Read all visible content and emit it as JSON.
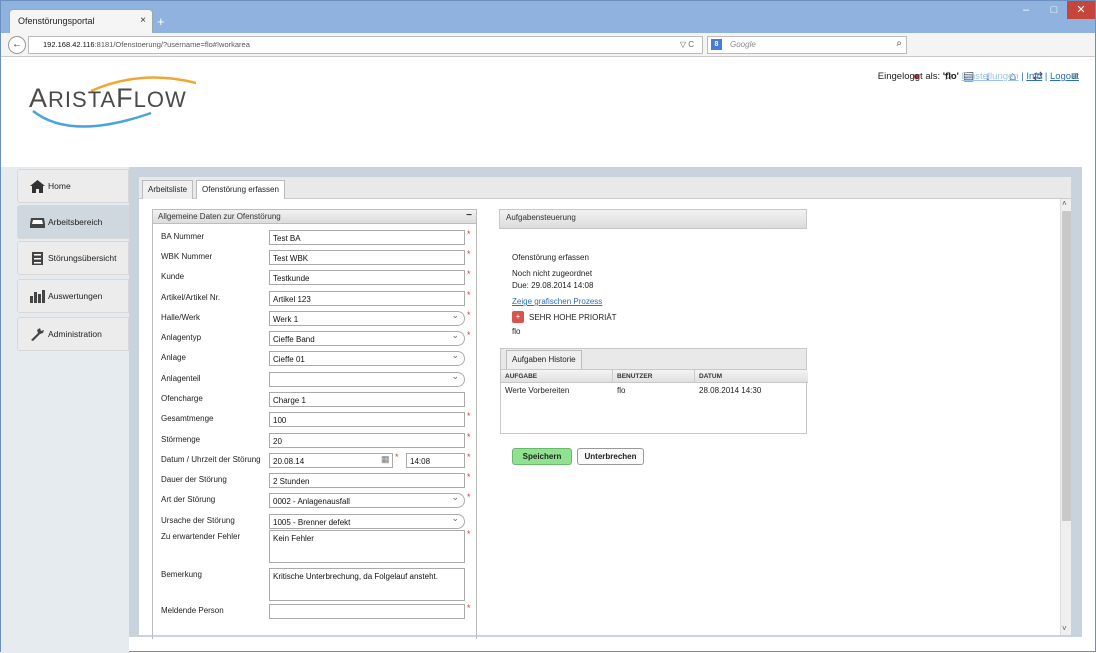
{
  "browser": {
    "tab_title": "Ofenstörungsportal",
    "tab_close": "×",
    "new_tab": "+",
    "url_host": "192.168.42.116",
    "url_rest": ":8181/Ofenstoerung/?username=flo#!workarea",
    "url_right": "▽ C",
    "search_engine_label": "8",
    "search_placeholder": "Google",
    "search_icon": "⌕",
    "toolbar_icons": [
      "abp-icon",
      "star-icon",
      "clipboard-icon",
      "download-icon",
      "home-icon",
      "extension-icon",
      "menu-icon"
    ],
    "window_buttons": [
      "–",
      "□",
      "✕"
    ]
  },
  "header": {
    "logo_text_big": "A",
    "logo_text_small": "RISTA",
    "logo_text_big2": "F",
    "logo_text_small2": "LOW",
    "logged_in_label": "Eingeloggt als:",
    "user": "'flo'",
    "settings_link": "Einstellungen",
    "sep": "|",
    "info_link": "Info",
    "logout_link": "Logout"
  },
  "sidebar": {
    "items": [
      {
        "label": "Home",
        "icon": "home-icon"
      },
      {
        "label": "Arbeitsbereich",
        "icon": "inbox-icon"
      },
      {
        "label": "Störungsübersicht",
        "icon": "server-icon"
      },
      {
        "label": "Auswertungen",
        "icon": "bar-chart-icon"
      },
      {
        "label": "Administration",
        "icon": "wrench-icon"
      }
    ],
    "active_index": 1
  },
  "tabs": [
    "Arbeitsliste",
    "Ofenstörung erfassen"
  ],
  "form": {
    "title": "Allgemeine Daten zur Ofenstörung",
    "collapse": "−",
    "fields": [
      {
        "label": "BA Nummer",
        "value": "Test BA",
        "type": "text",
        "required": true
      },
      {
        "label": "WBK Nummer",
        "value": "Test WBK",
        "type": "text",
        "required": true
      },
      {
        "label": "Kunde",
        "value": "Testkunde",
        "type": "text",
        "required": true
      },
      {
        "label": "Artikel/Artikel Nr.",
        "value": "Artikel 123",
        "type": "text",
        "required": true
      },
      {
        "label": "Halle/Werk",
        "value": "Werk 1",
        "type": "select",
        "required": true
      },
      {
        "label": "Anlagentyp",
        "value": "Cieffe Band",
        "type": "select",
        "required": true
      },
      {
        "label": "Anlage",
        "value": "Cieffe 01",
        "type": "select",
        "required": false
      },
      {
        "label": "Anlagenteil",
        "value": "",
        "type": "select",
        "required": false
      },
      {
        "label": "Ofencharge",
        "value": "Charge 1",
        "type": "text",
        "required": false
      },
      {
        "label": "Gesamtmenge",
        "value": "100",
        "type": "text",
        "required": true
      },
      {
        "label": "Störmenge",
        "value": "20",
        "type": "text",
        "required": true
      },
      {
        "label": "Datum / Uhrzeit der Störung",
        "value": "20.08.14",
        "time": "14:08",
        "type": "datetime",
        "required": true
      },
      {
        "label": "Dauer der Störung",
        "value": "2 Stunden",
        "type": "text",
        "required": true
      },
      {
        "label": "Art der Störung",
        "value": "0002 - Anlagenausfall",
        "type": "select",
        "required": true
      },
      {
        "label": "Ursache der Störung",
        "value": "1005 - Brenner defekt",
        "type": "select",
        "required": false
      },
      {
        "label": "Zu erwartender Fehler",
        "value": "Kein Fehler",
        "type": "textarea",
        "required": true
      },
      {
        "label": "Bemerkung",
        "value": "Kritische Unterbrechung, da Folgelauf ansteht.",
        "type": "textarea",
        "required": false
      },
      {
        "label": "Meldende Person",
        "value": "",
        "type": "text",
        "required": true
      }
    ]
  },
  "control": {
    "title": "Aufgabensteuerung",
    "task": "Ofenstörung erfassen",
    "assigned": "Noch nicht zugeordnet",
    "due": "Due: 29.08.2014 14:08",
    "process_link": "Zeige grafischen Prozess",
    "priority": "SEHR HOHE PRIORIÄT",
    "priority_icon": "+",
    "user": "flo",
    "history_tab": "Aufgaben Historie",
    "history_headers": [
      "AUFGABE",
      "BENUTZER",
      "DATUM"
    ],
    "history_rows": [
      [
        "Werte Vorbereiten",
        "flo",
        "28.08.2014 14:30"
      ]
    ],
    "save_label": "Speichern",
    "interrupt_label": "Unterbrechen"
  }
}
